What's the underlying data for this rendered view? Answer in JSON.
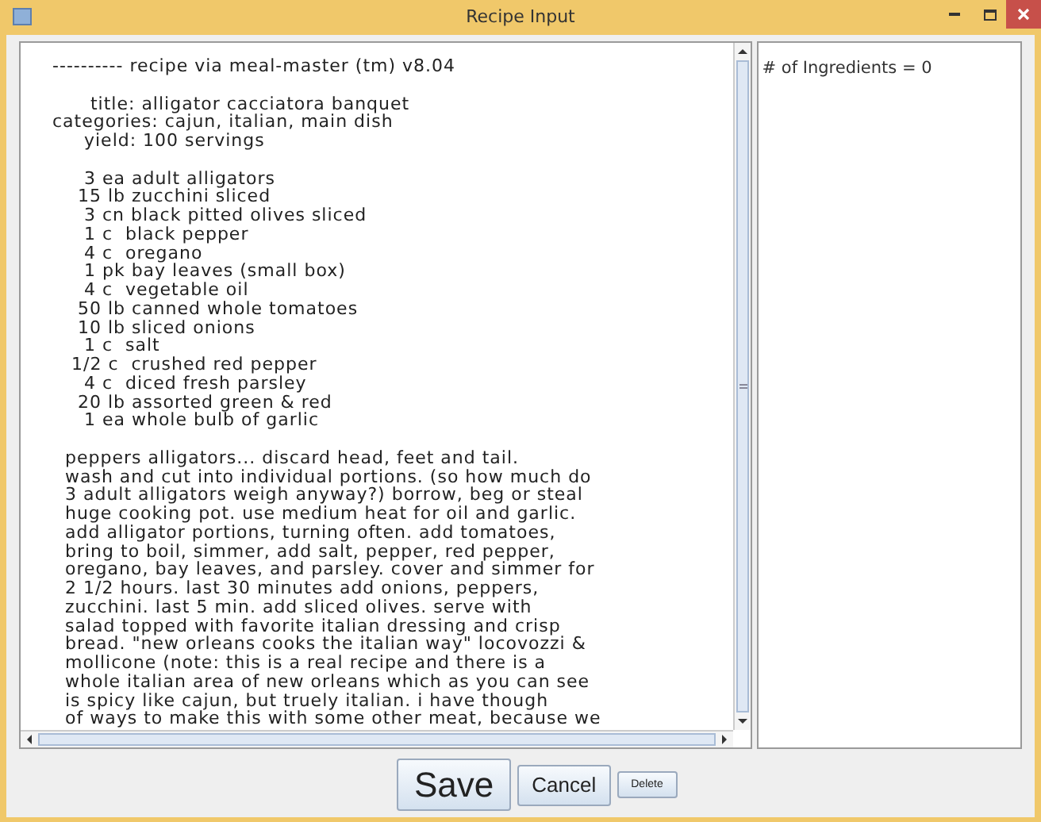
{
  "window": {
    "title": "Recipe Input"
  },
  "recipe_text": {
    "blocks": [
      [
        "---------- recipe via meal-master (tm) v8.04"
      ],
      [
        "      title: alligator cacciatora banquet",
        "categories: cajun, italian, main dish",
        "     yield: 100 servings"
      ],
      [
        "     3 ea adult alligators",
        "    15 lb zucchini sliced",
        "     3 cn black pitted olives sliced",
        "     1 c  black pepper",
        "     4 c  oregano",
        "     1 pk bay leaves (small box)",
        "     4 c  vegetable oil",
        "    50 lb canned whole tomatoes",
        "    10 lb sliced onions",
        "     1 c  salt",
        "   1/2 c  crushed red pepper",
        "     4 c  diced fresh parsley",
        "    20 lb assorted green & red",
        "     1 ea whole bulb of garlic"
      ],
      [
        "  peppers alligators... discard head, feet and tail.",
        "  wash and cut into individual portions. (so how much do",
        "  3 adult alligators weigh anyway?) borrow, beg or steal",
        "  huge cooking pot. use medium heat for oil and garlic.",
        "  add alligator portions, turning often. add tomatoes,",
        "  bring to boil, simmer, add salt, pepper, red pepper,",
        "  oregano, bay leaves, and parsley. cover and simmer for",
        "  2 1/2 hours. last 30 minutes add onions, peppers,",
        "  zucchini. last 5 min. add sliced olives. serve with",
        "  salad topped with favorite italian dressing and crisp",
        "  bread. \"new orleans cooks the italian way\" locovozzi &",
        "  mollicone (note: this is a real recipe and there is a",
        "  whole italian area of new orleans which as you can see",
        "  is spicy like cajun, but truely italian. i have though",
        "  of ways to make this with some other meat, because we"
      ]
    ]
  },
  "ingredients_panel": {
    "text": "# of Ingredients = 0"
  },
  "buttons": [
    {
      "label": "Save",
      "kind": "large"
    },
    {
      "label": "Cancel",
      "kind": "medium"
    },
    {
      "label": "Delete",
      "kind": "small"
    }
  ]
}
